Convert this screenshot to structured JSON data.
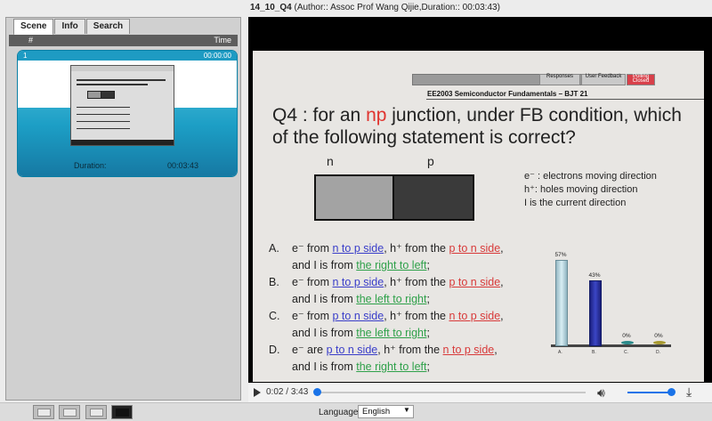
{
  "header": {
    "title": "14_10_Q4",
    "meta": "(Author:: Assoc Prof Wang Qijie,Duration:: 00:03:43)"
  },
  "left_panel": {
    "tabs": [
      {
        "label": "Scene"
      },
      {
        "label": "Info"
      },
      {
        "label": "Search"
      }
    ],
    "list_header": {
      "hash": "#",
      "time": "Time"
    },
    "scene": {
      "index": "1",
      "timestamp": "00:00:00",
      "duration_label": "Duration:",
      "duration_value": "00:03:43"
    }
  },
  "slide": {
    "toolbar_labels": [
      "Responses",
      "User Feedback",
      "Polling Closed"
    ],
    "header": "EE2003 Semiconductor Fundamentals – BJT   21",
    "question_pre": "Q4 : for an ",
    "question_np": "np",
    "question_post": " junction, under FB condition, which of the following statement is correct?",
    "n_label": "n",
    "p_label": "p",
    "legend": [
      "e⁻ : electrons moving direction",
      "h⁺: holes moving direction",
      "I  is the current direction"
    ],
    "options": [
      {
        "letter": "A.",
        "l1_a": "e⁻ from ",
        "l1_b": "n to p side",
        "l1_c": ", h⁺ from the ",
        "l1_d": "p to n side",
        "l1_e": ",",
        "l2_a": "and I is from ",
        "l2_b": "the right to left",
        "l2_c": ";"
      },
      {
        "letter": "B.",
        "l1_a": "e⁻ from ",
        "l1_b": "n to p side",
        "l1_c": ", h⁺ from the ",
        "l1_d": "p to n side",
        "l1_e": ",",
        "l2_a": "and I is from ",
        "l2_b": "the left to right",
        "l2_c": ";"
      },
      {
        "letter": "C.",
        "l1_a": "e⁻ from ",
        "l1_b": "p to n side",
        "l1_c": ", h⁺ from the ",
        "l1_d": "n to p side",
        "l1_e": ",",
        "l2_a": "and I is from ",
        "l2_b": "the left to right",
        "l2_c": ";"
      },
      {
        "letter": "D.",
        "l1_a": "e⁻ are ",
        "l1_b": "p to n side",
        "l1_c": ", h⁺ from the ",
        "l1_d": "n to p side",
        "l1_e": ",",
        "l2_a": "and I is from ",
        "l2_b": "the right to left",
        "l2_c": ";"
      }
    ]
  },
  "chart_data": {
    "type": "bar",
    "categories": [
      "A.",
      "B.",
      "C.",
      "D."
    ],
    "values": [
      57,
      43,
      0,
      0
    ],
    "value_labels": [
      "57%",
      "43%",
      "0%",
      "0%"
    ],
    "ylim": [
      0,
      100
    ],
    "colors": [
      "#c6e3ea",
      "#2a33a8",
      "#2b8a8a",
      "#a89a30"
    ]
  },
  "player": {
    "current_time": "0:02",
    "total_time": "3:43",
    "progress_fraction": 0.009,
    "volume_fraction": 1.0
  },
  "footer": {
    "language_label": "Language",
    "language_value": "English"
  }
}
